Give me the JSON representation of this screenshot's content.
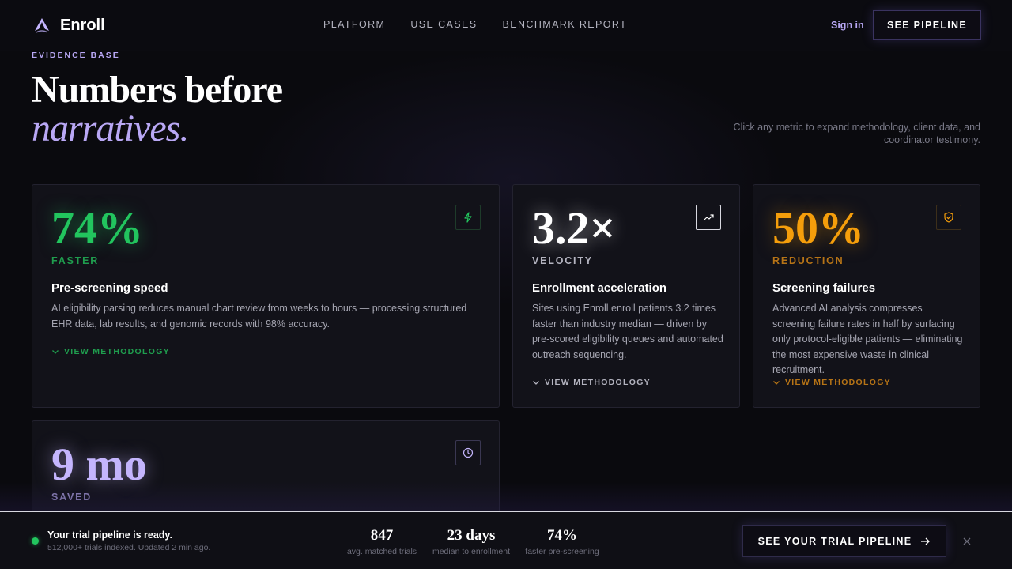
{
  "nav": {
    "brand": "Enroll",
    "links": [
      "PLATFORM",
      "USE CASES",
      "BENCHMARK REPORT"
    ],
    "signin": "Sign in",
    "cta": "SEE PIPELINE"
  },
  "hero": {
    "eyebrow": "EVIDENCE BASE",
    "headline_line1": "Numbers before",
    "headline_line2": "narratives.",
    "note": "Click any metric to expand methodology, client data, and coordinator testimony."
  },
  "cards": [
    {
      "metric": "74%",
      "label": "FASTER",
      "title": "Pre-screening speed",
      "description": "AI eligibility parsing reduces manual chart review from weeks to hours — processing structured EHR data, lab results, and genomic records with 98% accuracy.",
      "methodology": "VIEW METHODOLOGY",
      "icon": "lightning-icon",
      "accent": "#22c55e"
    },
    {
      "metric": "3.2×",
      "label": "VELOCITY",
      "title": "Enrollment acceleration",
      "description": "Sites using Enroll enroll patients 3.2 times faster than industry median — driven by pre-scored eligibility queues and automated outreach sequencing.",
      "methodology": "VIEW METHODOLOGY",
      "icon": "trending-up-icon",
      "accent": "#ffffff"
    },
    {
      "metric": "50%",
      "label": "REDUCTION",
      "title": "Screening failures",
      "description": "Advanced AI analysis compresses screening failure rates in half by surfacing only protocol-eligible patients — eliminating the most expensive waste in clinical recruitment.",
      "methodology": "VIEW METHODOLOGY",
      "icon": "shield-check-icon",
      "accent": "#f59e0b"
    },
    {
      "metric": "9 mo",
      "label": "SAVED",
      "icon": "clock-icon",
      "accent": "#c4b5fd"
    }
  ],
  "bottom_bar": {
    "title": "Your trial pipeline is ready.",
    "subtitle": "512,000+ trials indexed. Updated 2 min ago.",
    "stats": [
      {
        "value": "847",
        "label": "avg. matched trials"
      },
      {
        "value": "23 days",
        "label": "median to enrollment"
      },
      {
        "value": "74%",
        "label": "faster pre-screening"
      }
    ],
    "cta": "SEE YOUR TRIAL PIPELINE"
  }
}
